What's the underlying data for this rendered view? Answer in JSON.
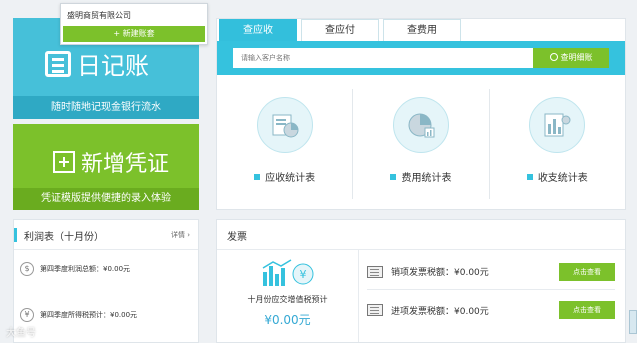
{
  "company": {
    "name": "盛明商贸有限公司",
    "new_account": "+ 新建账套"
  },
  "journal": {
    "title": "日记账",
    "subtitle": "随时随地记现金银行流水"
  },
  "voucher": {
    "title": "新增凭证",
    "subtitle": "凭证模版提供便捷的录入体验"
  },
  "tabs": [
    "查应收",
    "查应付",
    "查费用"
  ],
  "search": {
    "placeholder": "请输入客户名称",
    "button": "查明细账"
  },
  "stats": [
    {
      "label": "应收统计表",
      "icon": "receivable-report-icon"
    },
    {
      "label": "费用统计表",
      "icon": "expense-pie-icon"
    },
    {
      "label": "收支统计表",
      "icon": "income-expense-bar-icon"
    }
  ],
  "profit": {
    "title": "利润表（十月份）",
    "detail": "详情",
    "rows": [
      {
        "text": "第四季度利润总额：¥0.00元"
      },
      {
        "text": "第四季度所得税预计：¥0.00元"
      }
    ]
  },
  "invoice": {
    "title": "发票",
    "vat_caption": "十月份应交增值税预计",
    "vat_value": "¥0.00元",
    "rows": [
      {
        "text": "销项发票税额：¥0.00元",
        "button": "点击查看"
      },
      {
        "text": "进项发票税额：¥0.00元",
        "button": "点击查看"
      }
    ]
  },
  "watermark": "大鱼号",
  "colors": {
    "cyan": "#35c2de",
    "green": "#7cc12b",
    "dark_cyan": "#2fa9c4"
  }
}
